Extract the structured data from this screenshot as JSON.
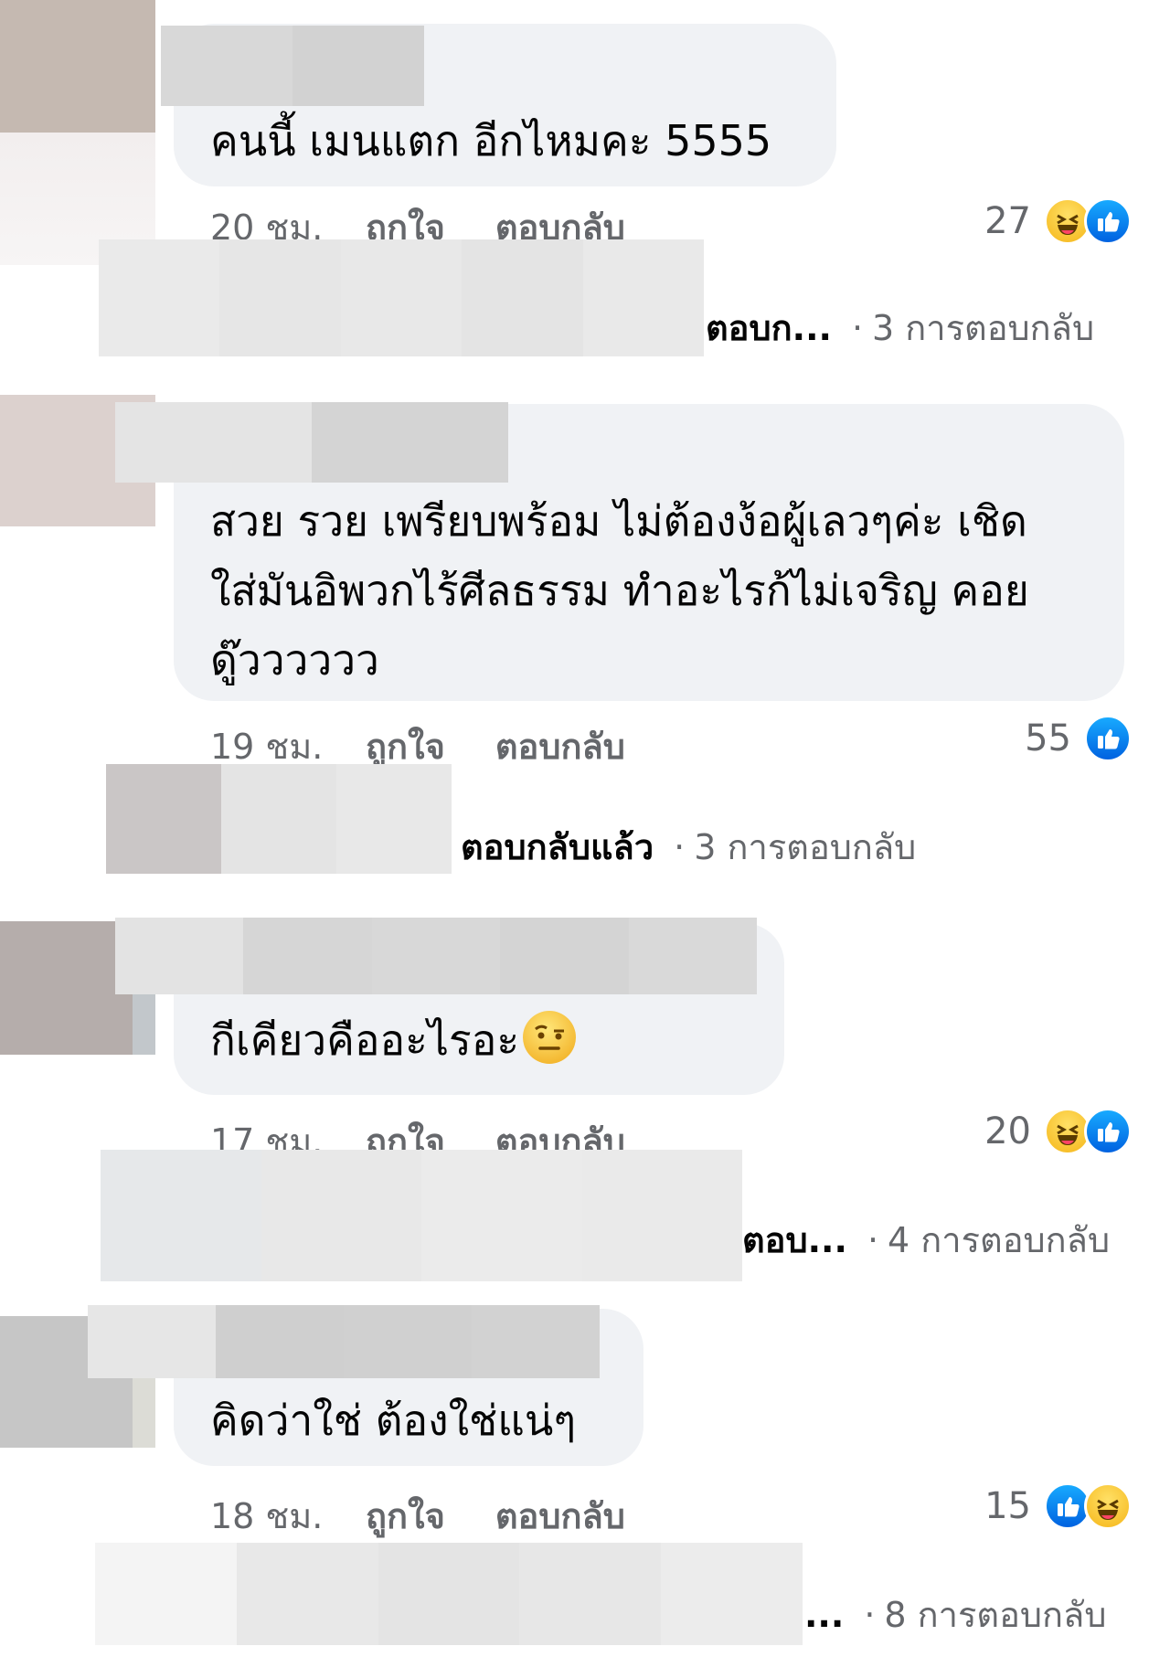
{
  "comments": [
    {
      "text_lines": [
        "คนนี้ เมนแตก อีกไหมคะ 5555"
      ],
      "time": "20 ชม.",
      "like_label": "ถูกใจ",
      "reply_label": "ตอบกลับ",
      "reaction_count": "27",
      "reactions": [
        "haha-icon",
        "like-icon"
      ],
      "reply_preview": "ตอบก...",
      "reply_count": "3 การตอบกลับ"
    },
    {
      "text_lines": [
        "สวย รวย เพรียบพร้อม ไม่ต้องง้อผู้เลวๆค่ะ เชิด",
        "ใส่มันอิพวกไร้ศีลธรรม ทำอะไรก้ไม่เจริญ คอย",
        "ดู๊วววววว"
      ],
      "time": "19 ชม.",
      "like_label": "ถูกใจ",
      "reply_label": "ตอบกลับ",
      "reaction_count": "55",
      "reactions": [
        "like-icon"
      ],
      "reply_preview": "ตอบกลับแล้ว",
      "reply_count": "3 การตอบกลับ"
    },
    {
      "text_lines": [
        "กีเคียวคืออะไรอะ"
      ],
      "emoji": "raised-eyebrow-emoji",
      "time": "17 ชม.",
      "like_label": "ถูกใจ",
      "reply_label": "ตอบกลับ",
      "reaction_count": "20",
      "reactions": [
        "haha-icon",
        "like-icon"
      ],
      "reply_preview": "ตอบ...",
      "reply_count": "4 การตอบกลับ"
    },
    {
      "text_lines": [
        "คิดว่าใช่ ต้องใช่แน่ๆ"
      ],
      "time": "18 ชม.",
      "like_label": "ถูกใจ",
      "reply_label": "ตอบกลับ",
      "reaction_count": "15",
      "reactions": [
        "like-icon",
        "haha-icon"
      ],
      "reply_preview": "...",
      "reply_count": "8 การตอบกลับ"
    }
  ],
  "reply_separator": "·",
  "colors": {
    "like_blue": "#1877f2",
    "bubble_gray": "#f0f2f5",
    "meta_gray": "#65676b"
  }
}
